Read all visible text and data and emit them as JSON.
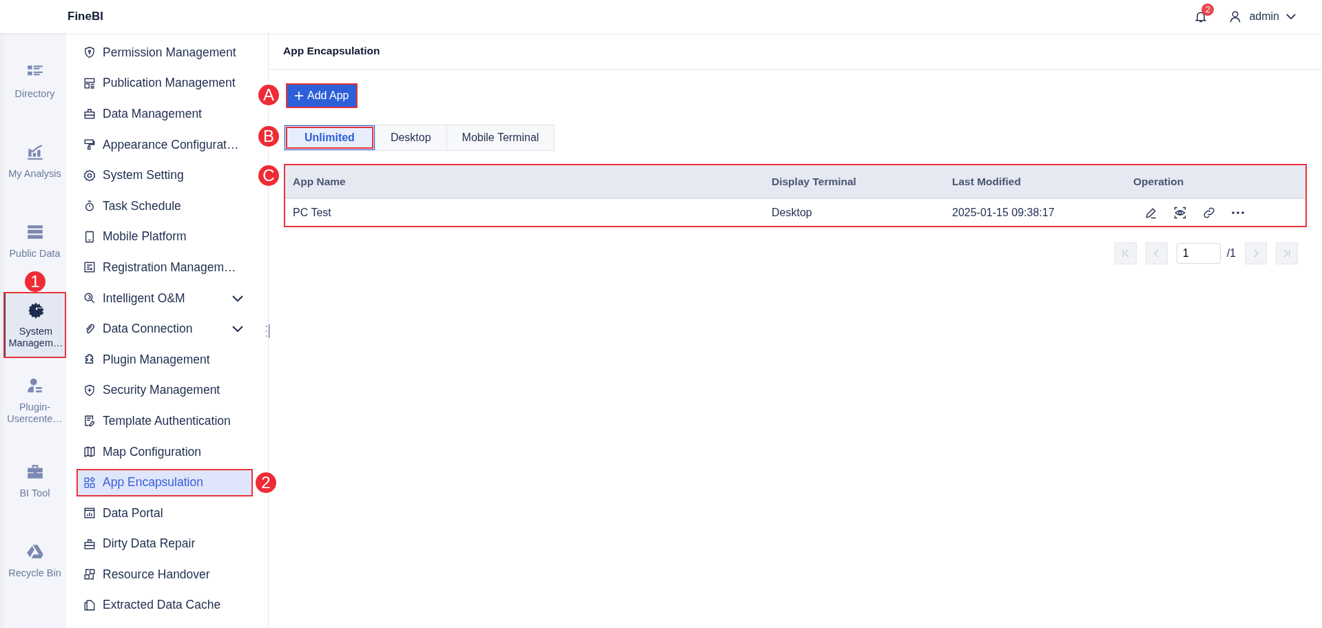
{
  "header": {
    "logo": "FineBI",
    "notifications": {
      "count": "2"
    },
    "user": {
      "name": "admin"
    }
  },
  "rail": [
    {
      "label": "Directory",
      "selected": false
    },
    {
      "label": "My Analysis",
      "selected": false
    },
    {
      "label": "Public Data",
      "selected": false
    },
    {
      "label": "System Managem…",
      "selected": true,
      "callout": "1"
    },
    {
      "label": "Plugin-Usercente…",
      "selected": false
    },
    {
      "label": "BI Tool",
      "selected": false
    },
    {
      "label": "Recycle Bin",
      "selected": false
    }
  ],
  "menu": [
    {
      "label": "Permission Management",
      "kind": "link",
      "selected": false
    },
    {
      "label": "Publication Management",
      "kind": "link",
      "selected": false
    },
    {
      "label": "Data Management",
      "kind": "link",
      "selected": false
    },
    {
      "label": "Appearance Configurat…",
      "kind": "link",
      "selected": false
    },
    {
      "label": "System Setting",
      "kind": "link",
      "selected": false
    },
    {
      "label": "Task Schedule",
      "kind": "link",
      "selected": false
    },
    {
      "label": "Mobile Platform",
      "kind": "link",
      "selected": false
    },
    {
      "label": "Registration Managem…",
      "kind": "link",
      "selected": false
    },
    {
      "label": "Intelligent O&M",
      "kind": "group",
      "selected": false
    },
    {
      "label": "Data Connection",
      "kind": "group",
      "selected": false
    },
    {
      "label": "Plugin Management",
      "kind": "link",
      "selected": false
    },
    {
      "label": "Security Management",
      "kind": "link",
      "selected": false
    },
    {
      "label": "Template Authentication",
      "kind": "link",
      "selected": false
    },
    {
      "label": "Map Configuration",
      "kind": "link",
      "selected": false
    },
    {
      "label": "App Encapsulation",
      "kind": "link",
      "selected": true,
      "callout": "2"
    },
    {
      "label": "Data Portal",
      "kind": "link",
      "selected": false
    },
    {
      "label": "Dirty Data Repair",
      "kind": "link",
      "selected": false
    },
    {
      "label": "Resource Handover",
      "kind": "link",
      "selected": false
    },
    {
      "label": "Extracted Data Cache",
      "kind": "link",
      "selected": false
    }
  ],
  "page": {
    "title": "App Encapsulation",
    "add_button": {
      "label": "Add App",
      "callout": "A"
    },
    "filter_tabs": {
      "callout": "B",
      "items": [
        {
          "label": "Unlimited",
          "selected": true
        },
        {
          "label": "Desktop",
          "selected": false
        },
        {
          "label": "Mobile Terminal",
          "selected": false
        }
      ]
    },
    "table": {
      "callout": "C",
      "columns": [
        "App Name",
        "Display Terminal",
        "Last Modified",
        "Operation"
      ],
      "rows": [
        {
          "cells": [
            "PC Test",
            "Desktop",
            "2025-01-15 09:38:17"
          ]
        }
      ]
    },
    "pagination": {
      "nav": [
        {
          "kind": "first",
          "disabled": true
        },
        {
          "kind": "prev",
          "disabled": true
        },
        {
          "kind": "next",
          "disabled": true
        },
        {
          "kind": "last",
          "disabled": true
        }
      ],
      "page": "1",
      "total": "/1"
    }
  }
}
